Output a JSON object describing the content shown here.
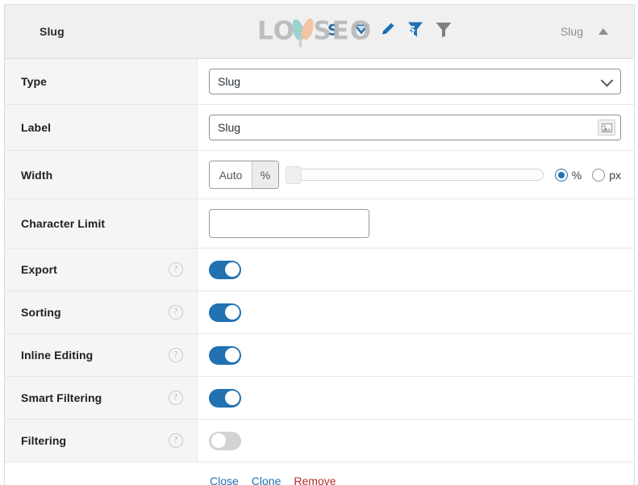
{
  "header": {
    "title": "Slug",
    "right_label": "Slug",
    "collapse_icon": "caret-up-icon",
    "watermark_text": "LOYSEO",
    "icons": [
      {
        "name": "sorting-icon",
        "color": "#2a6fa8"
      },
      {
        "name": "filter-triangle-icon",
        "color": "#2a6fa8"
      },
      {
        "name": "inline-edit-pencil-icon",
        "color": "#1e6fba"
      },
      {
        "name": "smart-filtering-icon",
        "color": "#2271b1"
      },
      {
        "name": "filtering-funnel-icon",
        "color": "#7f7f7f"
      }
    ]
  },
  "rows": [
    {
      "label": "Type",
      "control": "select",
      "value": "Slug",
      "has_help": false,
      "dropdown_icon": "chevron-down-icon"
    },
    {
      "label": "Label",
      "control": "text",
      "value": "Slug",
      "placeholder": "",
      "has_help": false,
      "addon_icon": "image-picker-icon"
    },
    {
      "label": "Width",
      "control": "width",
      "width_value": "Auto",
      "width_unit_addon": "%",
      "slider_value": 0,
      "slider_min": 0,
      "slider_max": 100,
      "units": [
        {
          "label": "%",
          "selected": true
        },
        {
          "label": "px",
          "selected": false
        }
      ],
      "has_help": false
    },
    {
      "label": "Character Limit",
      "control": "text",
      "value": "",
      "placeholder": "",
      "has_help": false
    },
    {
      "label": "Export",
      "control": "toggle",
      "toggle_on": true,
      "has_help": true
    },
    {
      "label": "Sorting",
      "control": "toggle",
      "toggle_on": true,
      "has_help": true
    },
    {
      "label": "Inline Editing",
      "control": "toggle",
      "toggle_on": true,
      "has_help": true
    },
    {
      "label": "Smart Filtering",
      "control": "toggle",
      "toggle_on": true,
      "has_help": true
    },
    {
      "label": "Filtering",
      "control": "toggle",
      "toggle_on": false,
      "has_help": true
    }
  ],
  "help_glyph": "?",
  "actions": {
    "close": "Close",
    "clone": "Clone",
    "remove": "Remove"
  },
  "colors": {
    "accent_blue": "#2271b1",
    "danger_red": "#b32d2e",
    "label_bg": "#f5f5f6",
    "header_bg": "#f0f0f1",
    "border": "#dcdcde",
    "toggle_off": "#d3d3d6"
  }
}
